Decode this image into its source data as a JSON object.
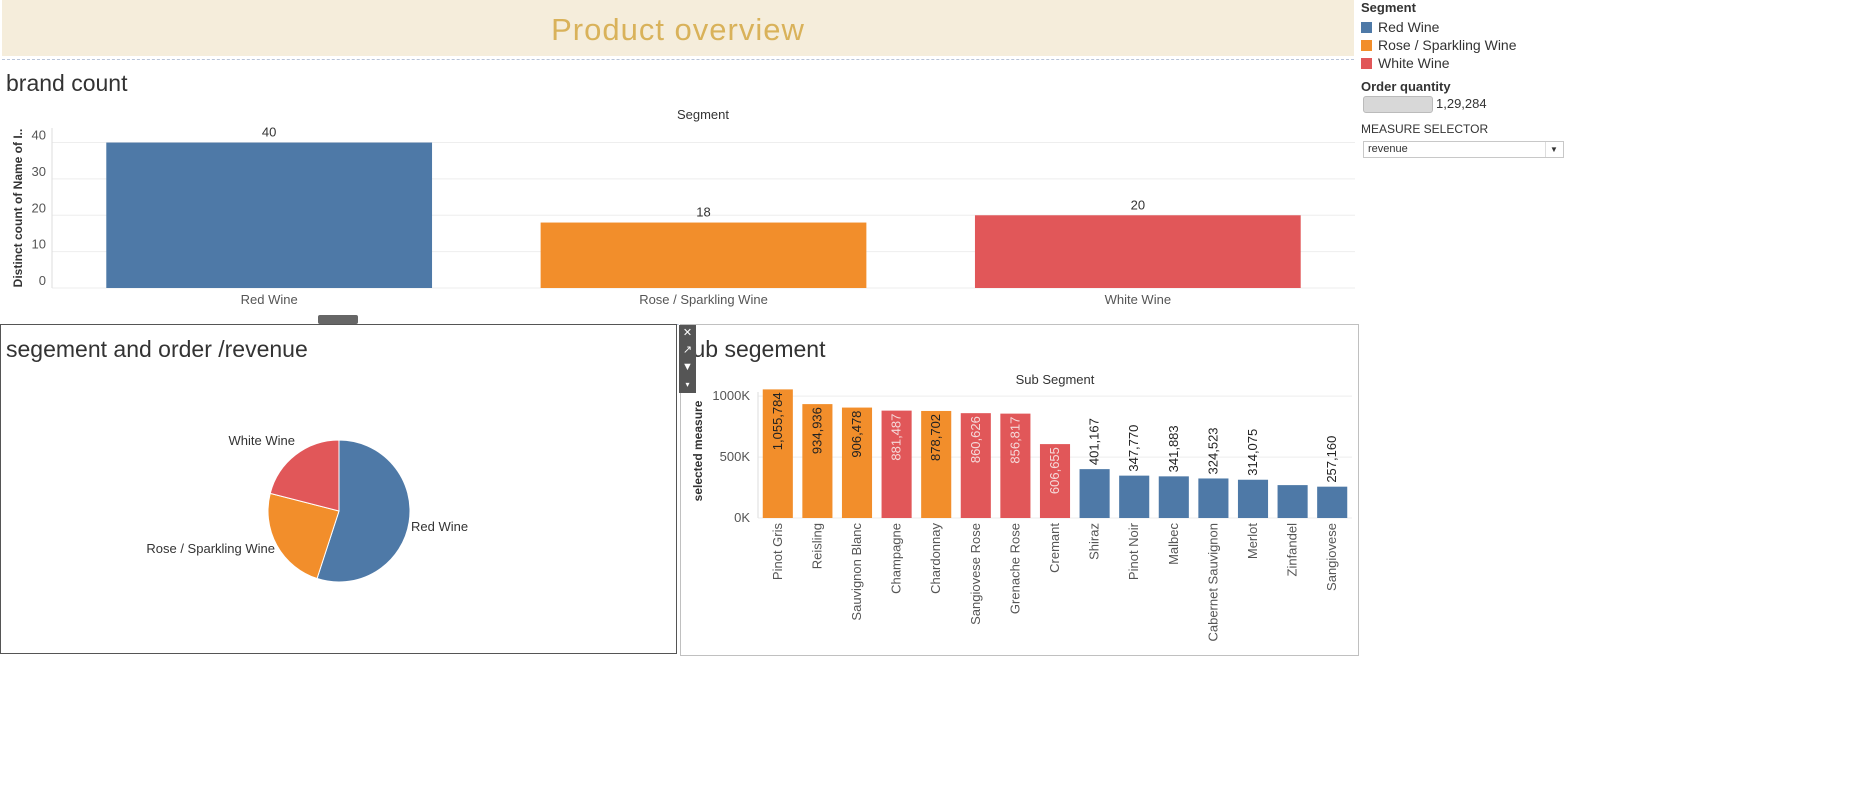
{
  "page_title": "Product overview",
  "legend": {
    "title": "Segment",
    "items": [
      {
        "label": "Red Wine",
        "color": "#4e79a7"
      },
      {
        "label": "Rose / Sparkling Wine",
        "color": "#f28e2b"
      },
      {
        "label": "White Wine",
        "color": "#e15759"
      }
    ]
  },
  "order_quantity": {
    "label": "Order quantity",
    "value": "1,29,284"
  },
  "measure_selector": {
    "label": "MEASURE SELECTOR",
    "value": "revenue"
  },
  "chart_data": [
    {
      "id": "brand_count",
      "type": "bar",
      "title": "brand count",
      "header": "Segment",
      "ylabel": "Distinct count of Name of I..",
      "categories": [
        "Red Wine",
        "Rose / Sparkling Wine",
        "White Wine"
      ],
      "values": [
        40,
        18,
        20
      ],
      "data_labels": [
        "40",
        "18",
        "20"
      ],
      "colors": [
        "#4e79a7",
        "#f28e2b",
        "#e15759"
      ],
      "yticks": [
        0,
        10,
        20,
        30,
        40
      ],
      "ylim": [
        0,
        44
      ]
    },
    {
      "id": "segment_pie",
      "type": "pie",
      "title": "segement and order /revenue",
      "slices": [
        {
          "label": "Red Wine",
          "value": 55,
          "color": "#4e79a7"
        },
        {
          "label": "Rose / Sparkling Wine",
          "value": 24,
          "color": "#f28e2b"
        },
        {
          "label": "White Wine",
          "value": 21,
          "color": "#e15759"
        }
      ]
    },
    {
      "id": "sub_segment",
      "type": "bar",
      "title": "sub segement",
      "header": "Sub Segment",
      "ylabel": "selected measure",
      "categories": [
        "Pinot Gris",
        "Reisling",
        "Sauvignon Blanc",
        "Champagne",
        "Chardonnay",
        "Sangiovese Rose",
        "Grenache Rose",
        "Cremant",
        "Shiraz",
        "Pinot Noir",
        "Malbec",
        "Cabernet Sauvignon",
        "Merlot",
        "Zinfandel",
        "Sangiovese"
      ],
      "values": [
        1055784,
        934936,
        906478,
        881487,
        878702,
        860626,
        856817,
        606655,
        401167,
        347770,
        341883,
        324523,
        314075,
        270000,
        257160
      ],
      "data_labels": [
        "1,055,784",
        "934,936",
        "906,478",
        "881,487",
        "878,702",
        "860,626",
        "856,817",
        "606,655",
        "401,167",
        "347,770",
        "341,883",
        "324,523",
        "314,075",
        "",
        "257,160"
      ],
      "colors": [
        "#f28e2b",
        "#f28e2b",
        "#f28e2b",
        "#e15759",
        "#f28e2b",
        "#e15759",
        "#e15759",
        "#e15759",
        "#4e79a7",
        "#4e79a7",
        "#4e79a7",
        "#4e79a7",
        "#4e79a7",
        "#4e79a7",
        "#4e79a7"
      ],
      "yticks": [
        0,
        500000,
        1000000
      ],
      "ytick_labels": [
        "0K",
        "500K",
        "1000K"
      ],
      "ylim": [
        0,
        1100000
      ]
    }
  ]
}
